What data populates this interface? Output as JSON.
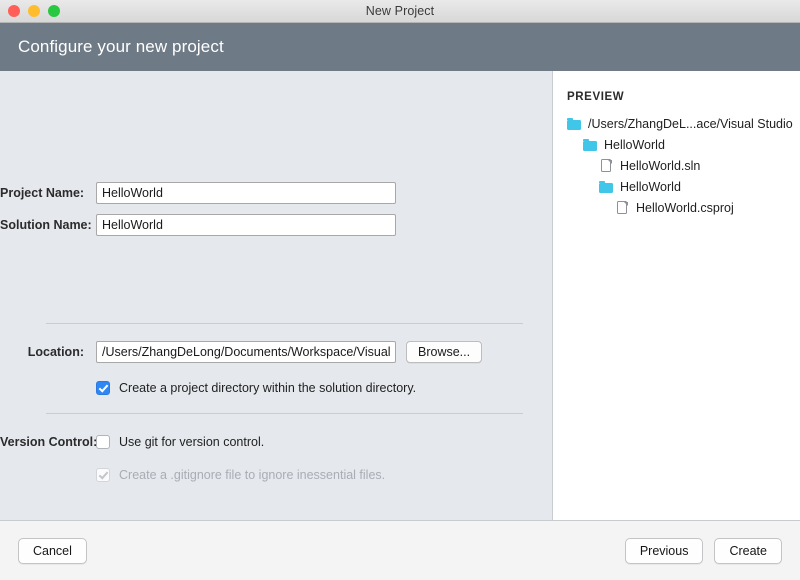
{
  "window": {
    "title": "New Project",
    "traffic_lights": [
      {
        "name": "close-button",
        "color": "#ff5f57"
      },
      {
        "name": "minimize-button",
        "color": "#ffbd2e"
      },
      {
        "name": "maximize-button",
        "color": "#28c840"
      }
    ]
  },
  "banner": {
    "title": "Configure your new project",
    "background": "#6e7a86"
  },
  "form": {
    "project_name": {
      "label": "Project Name:",
      "value": "HelloWorld",
      "placeholder": ""
    },
    "solution_name": {
      "label": "Solution Name:",
      "value": "HelloWorld",
      "placeholder": ""
    },
    "location": {
      "label": "Location:",
      "value": "/Users/ZhangDeLong/Documents/Workspace/Visual Studi",
      "placeholder": "",
      "browse_label": "Browse..."
    },
    "project_dir_checkbox": {
      "label": "Create a project directory within the solution directory.",
      "checked": true,
      "enabled": true
    },
    "version_control": {
      "label": "Version Control:",
      "use_git": {
        "label": "Use git for version control.",
        "checked": false,
        "enabled": true
      },
      "gitignore": {
        "label": "Create a .gitignore file to ignore inessential files.",
        "checked": true,
        "enabled": false
      }
    }
  },
  "preview": {
    "title": "PREVIEW",
    "folder_color": "#3fc6e8",
    "tree": [
      {
        "label": "/Users/ZhangDeL...ace/Visual Studio",
        "icon": "folder-icon",
        "depth": 0
      },
      {
        "label": "HelloWorld",
        "icon": "folder-icon",
        "depth": 1
      },
      {
        "label": "HelloWorld.sln",
        "icon": "file-icon",
        "depth": 2
      },
      {
        "label": "HelloWorld",
        "icon": "folder-icon",
        "depth": 2
      },
      {
        "label": "HelloWorld.csproj",
        "icon": "file-icon",
        "depth": 3
      }
    ]
  },
  "footer": {
    "cancel_label": "Cancel",
    "previous_label": "Previous",
    "create_label": "Create"
  }
}
